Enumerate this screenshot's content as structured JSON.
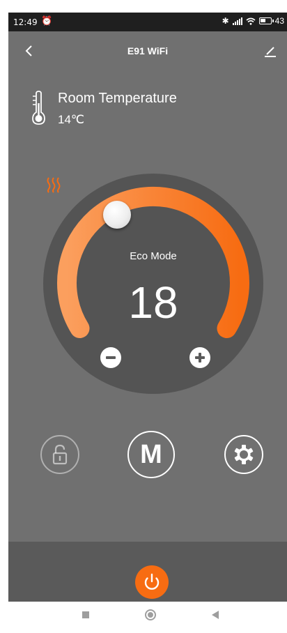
{
  "status_bar": {
    "time": "12:49",
    "alarm_icon": "alarm-clock-icon",
    "bluetooth_icon": "bluetooth-icon",
    "signal_icon": "cellular-signal-icon",
    "wifi_icon": "wifi-icon",
    "battery_icon": "battery-icon",
    "battery_percent": "43"
  },
  "header": {
    "back_icon": "chevron-left-icon",
    "title": "E91 WiFi",
    "edit_icon": "pencil-edit-icon"
  },
  "room": {
    "icon": "thermometer-icon",
    "label": "Room Temperature",
    "value": "14℃"
  },
  "thermostat": {
    "mode_label": "Eco Mode",
    "set_temperature": "18",
    "minus_icon": "minus-icon",
    "plus_icon": "plus-icon",
    "heating_icon": "heat-waves-icon"
  },
  "controls": {
    "lock_icon": "lock-icon",
    "mode_button_label": "M",
    "settings_icon": "gear-icon"
  },
  "footer": {
    "power_icon": "power-icon"
  },
  "navigation": {
    "recents_icon": "square-recents-icon",
    "home_icon": "circle-home-icon",
    "back_icon": "triangle-back-icon"
  },
  "colors": {
    "accent": "#f76c12",
    "background": "#707070",
    "dial": "#545454",
    "bottom_bar": "#5a5a5a"
  }
}
